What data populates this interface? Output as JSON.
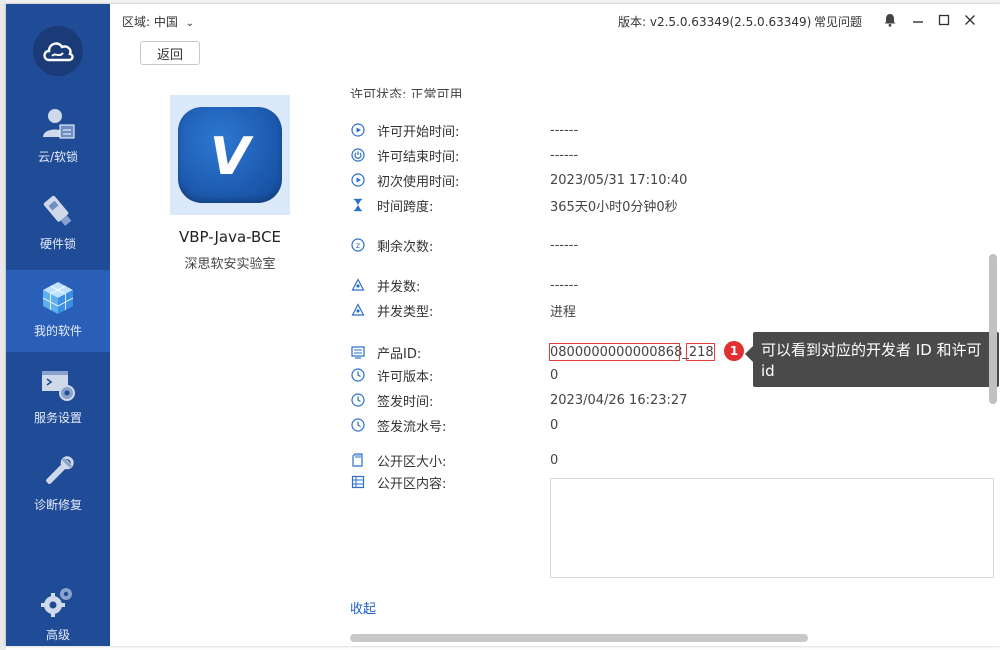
{
  "sidebar": {
    "items": [
      {
        "label": "云/软锁",
        "icon": "user-card-icon"
      },
      {
        "label": "硬件锁",
        "icon": "usb-key-icon"
      },
      {
        "label": "我的软件",
        "icon": "cube-icon",
        "active": true
      },
      {
        "label": "服务设置",
        "icon": "terminal-gear-icon"
      },
      {
        "label": "诊断修复",
        "icon": "wrench-icon"
      },
      {
        "label": "高级",
        "icon": "gears-icon"
      }
    ]
  },
  "titlebar": {
    "region_label": "区域:",
    "region_value": "中国",
    "version": "版本: v2.5.0.63349(2.5.0.63349)",
    "faq": "常见问题"
  },
  "back_label": "返回",
  "software": {
    "name": "VBP-Java-BCE",
    "vendor": "深思软安实验室",
    "logo_letter": "V"
  },
  "partial_row": "许可状态:            正常可用",
  "details": [
    {
      "label": "许可开始时间:",
      "value": "------",
      "icon": "play-circle-icon"
    },
    {
      "label": "许可结束时间:",
      "value": "------",
      "icon": "power-circle-icon"
    },
    {
      "label": "初次使用时间:",
      "value": "2023/05/31 17:10:40",
      "icon": "play-circle-icon"
    },
    {
      "label": "时间跨度:",
      "value": "365天0小时0分钟0秒",
      "icon": "hourglass-icon"
    },
    {
      "label": "剩余次数:",
      "value": "------",
      "icon": "counter-icon"
    },
    {
      "label": "并发数:",
      "value": "------",
      "icon": "triangle-nodes-icon"
    },
    {
      "label": "并发类型:",
      "value": "进程",
      "icon": "triangle-nodes-icon"
    },
    {
      "label": "产品ID:",
      "value": "",
      "icon": "monitor-icon"
    },
    {
      "label": "许可版本:",
      "value": "0",
      "icon": "clock-icon"
    },
    {
      "label": "签发时间:",
      "value": "2023/04/26 16:23:27",
      "icon": "clock-icon"
    },
    {
      "label": "签发流水号:",
      "value": "0",
      "icon": "clock-icon"
    },
    {
      "label": "公开区大小:",
      "value": "0",
      "icon": "sd-card-icon"
    },
    {
      "label": "公开区内容:",
      "value": "",
      "icon": "grid-icon"
    }
  ],
  "product_id": {
    "developer_part": "0800000000000868",
    "separator": "_",
    "license_part": "218"
  },
  "annotation": {
    "badge": "1",
    "text": "可以看到对应的开发者 ID 和许可 id"
  },
  "collapse_label": "收起",
  "colors": {
    "sidebar": "#1f4b97",
    "sidebar_active": "#2a5fb8",
    "highlight_box": "#e04040",
    "badge": "#e03030",
    "link": "#2161c4"
  }
}
